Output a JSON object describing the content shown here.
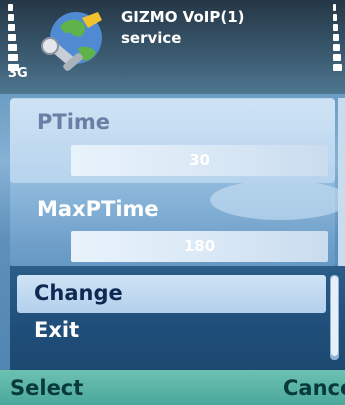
{
  "status": {
    "network": "3G",
    "app_icon": "voip-settings-icon",
    "title_line1": "GIZMO VoIP(1)",
    "title_line2": "service"
  },
  "settings": [
    {
      "label": "PTime",
      "value": "30"
    },
    {
      "label": "MaxPTime",
      "value": "180"
    }
  ],
  "menu": {
    "items": [
      {
        "label": "Change",
        "selected": true
      },
      {
        "label": "Exit",
        "selected": false
      }
    ]
  },
  "softkeys": {
    "left": "Select",
    "right": "Cancel"
  },
  "colors": {
    "softkey_bar": "#4aa89a",
    "menu_bg": "#1f4e7a",
    "highlight": "#cfe3f5"
  }
}
